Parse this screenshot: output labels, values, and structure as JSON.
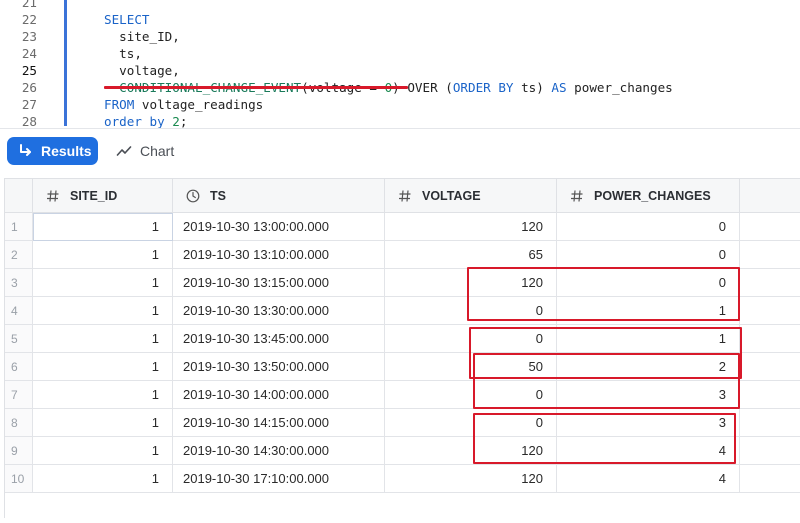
{
  "editor": {
    "lines": [
      {
        "num": "21",
        "tokens": []
      },
      {
        "num": "22",
        "tokens": [
          {
            "t": "SELECT",
            "c": "kw"
          }
        ]
      },
      {
        "num": "23",
        "tokens": [
          {
            "t": "  site_ID,",
            "c": "id"
          }
        ]
      },
      {
        "num": "24",
        "tokens": [
          {
            "t": "  ts,",
            "c": "id"
          }
        ]
      },
      {
        "num": "25",
        "tokens": [
          {
            "t": "  voltage,",
            "c": "id"
          }
        ]
      },
      {
        "num": "26",
        "tokens": [
          {
            "t": "  ",
            "c": "id"
          },
          {
            "t": "CONDITIONAL_CHANGE_EVENT",
            "c": "fn"
          },
          {
            "t": "(voltage = ",
            "c": "id"
          },
          {
            "t": "0",
            "c": "num"
          },
          {
            "t": ") OVER (",
            "c": "id"
          },
          {
            "t": "ORDER BY",
            "c": "kw"
          },
          {
            "t": " ts) ",
            "c": "id"
          },
          {
            "t": "AS",
            "c": "kw"
          },
          {
            "t": " power_changes",
            "c": "id"
          }
        ]
      },
      {
        "num": "27",
        "tokens": [
          {
            "t": "FROM",
            "c": "kw"
          },
          {
            "t": " voltage_readings",
            "c": "id"
          }
        ]
      },
      {
        "num": "28",
        "tokens": [
          {
            "t": "order by",
            "c": "kw"
          },
          {
            "t": " ",
            "c": "id"
          },
          {
            "t": "2",
            "c": "num"
          },
          {
            "t": ";",
            "c": "id"
          }
        ]
      }
    ],
    "current_line": "25"
  },
  "toolbar": {
    "results_label": "Results",
    "chart_label": "Chart"
  },
  "table": {
    "columns": [
      {
        "label": "SITE_ID",
        "icon": "hash-icon"
      },
      {
        "label": "TS",
        "icon": "clock-icon"
      },
      {
        "label": "VOLTAGE",
        "icon": "hash-icon"
      },
      {
        "label": "POWER_CHANGES",
        "icon": "hash-icon"
      }
    ],
    "rows": [
      {
        "n": "1",
        "site_id": "1",
        "ts": "2019-10-30 13:00:00.000",
        "voltage": "120",
        "power_changes": "0"
      },
      {
        "n": "2",
        "site_id": "1",
        "ts": "2019-10-30 13:10:00.000",
        "voltage": "65",
        "power_changes": "0"
      },
      {
        "n": "3",
        "site_id": "1",
        "ts": "2019-10-30 13:15:00.000",
        "voltage": "120",
        "power_changes": "0"
      },
      {
        "n": "4",
        "site_id": "1",
        "ts": "2019-10-30 13:30:00.000",
        "voltage": "0",
        "power_changes": "1"
      },
      {
        "n": "5",
        "site_id": "1",
        "ts": "2019-10-30 13:45:00.000",
        "voltage": "0",
        "power_changes": "1"
      },
      {
        "n": "6",
        "site_id": "1",
        "ts": "2019-10-30 13:50:00.000",
        "voltage": "50",
        "power_changes": "2"
      },
      {
        "n": "7",
        "site_id": "1",
        "ts": "2019-10-30 14:00:00.000",
        "voltage": "0",
        "power_changes": "3"
      },
      {
        "n": "8",
        "site_id": "1",
        "ts": "2019-10-30 14:15:00.000",
        "voltage": "0",
        "power_changes": "3"
      },
      {
        "n": "9",
        "site_id": "1",
        "ts": "2019-10-30 14:30:00.000",
        "voltage": "120",
        "power_changes": "4"
      },
      {
        "n": "10",
        "site_id": "1",
        "ts": "2019-10-30 17:10:00.000",
        "voltage": "120",
        "power_changes": "4"
      }
    ]
  },
  "colors": {
    "accent": "#1f6fe0",
    "annotation": "#d8192a",
    "keyword": "#1a63c8",
    "function": "#1a7a5a"
  }
}
